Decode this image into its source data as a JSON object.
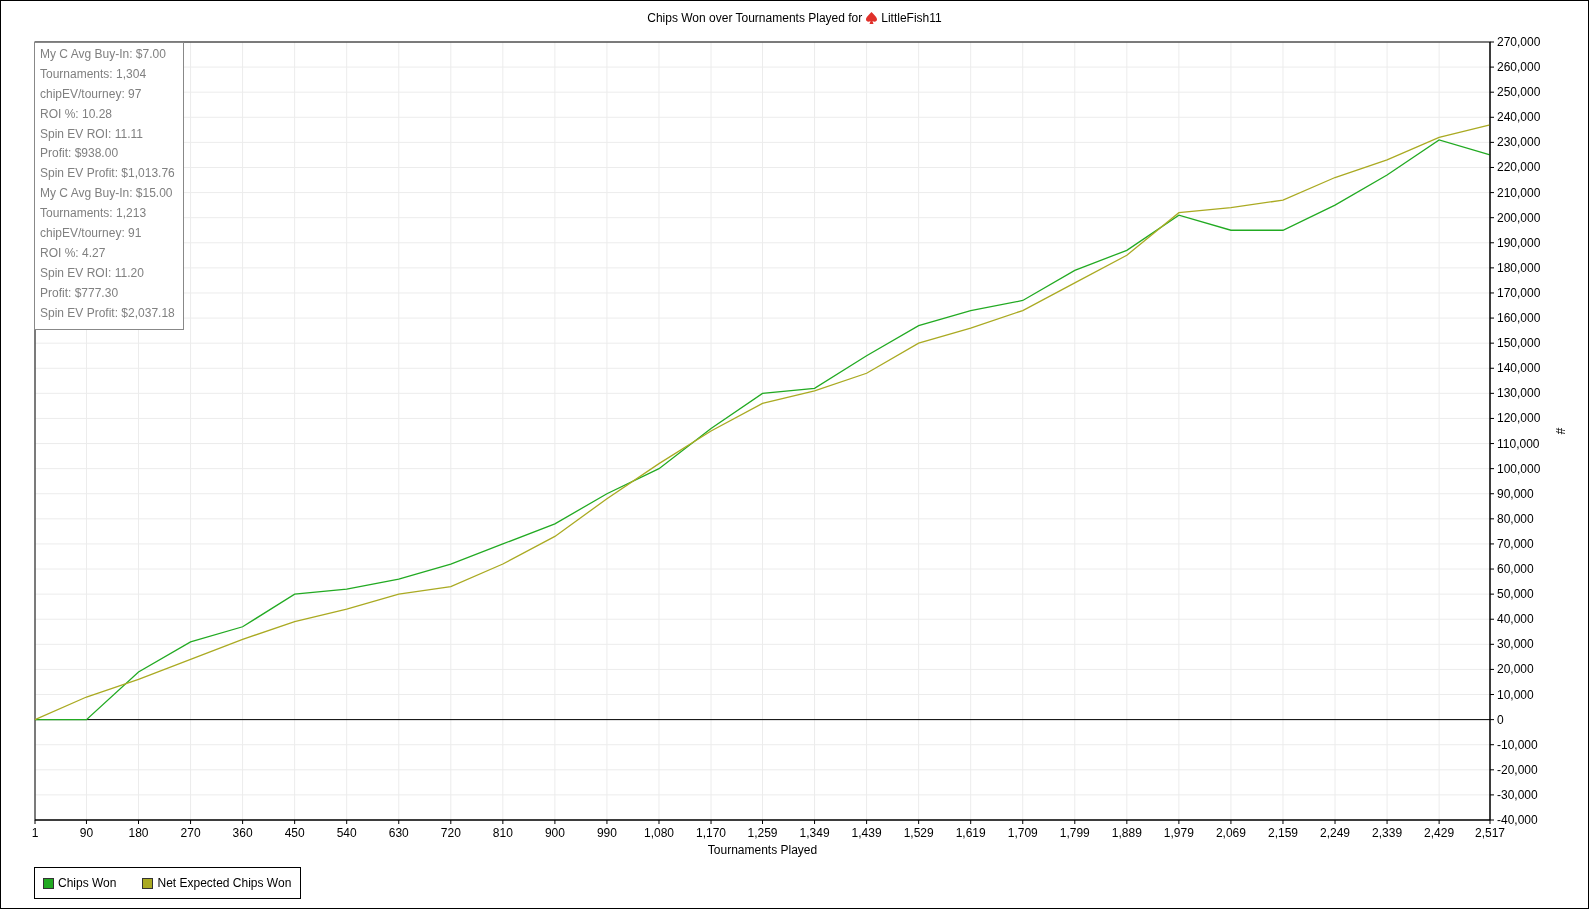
{
  "chart": {
    "title": "Chips Won over Tournaments Played for",
    "player": "LittleFish11",
    "stats": [
      "My C Avg Buy-In: $7.00",
      "Tournaments: 1,304",
      "chipEV/tourney: 97",
      "ROI %: 10.28",
      "Spin EV ROI: 11.11",
      "Profit: $938.00",
      "Spin EV Profit: $1,013.76",
      "My C Avg Buy-In: $15.00",
      "Tournaments: 1,213",
      "chipEV/tourney: 91",
      "ROI %: 4.27",
      "Spin EV ROI: 11.20",
      "Profit: $777.30",
      "Spin EV Profit: $2,037.18"
    ],
    "chart_data": {
      "type": "line",
      "xlabel": "Tournaments Played",
      "ylabel": "#",
      "x": [
        1,
        90,
        180,
        270,
        360,
        450,
        540,
        630,
        720,
        810,
        900,
        990,
        1080,
        1170,
        1259,
        1349,
        1439,
        1529,
        1619,
        1709,
        1799,
        1889,
        1979,
        2069,
        2159,
        2249,
        2339,
        2429,
        2517
      ],
      "series": [
        {
          "name": "Chips Won",
          "color": "#22aa22",
          "values": [
            0,
            0,
            19000,
            31000,
            37000,
            50000,
            52000,
            56000,
            62000,
            70000,
            78000,
            90000,
            100000,
            116000,
            130000,
            132000,
            145000,
            157000,
            163000,
            167000,
            179000,
            187000,
            201000,
            195000,
            195000,
            205000,
            217000,
            231000,
            225000
          ]
        },
        {
          "name": "Net Expected Chips Won",
          "color": "#aaaa22",
          "values": [
            0,
            9000,
            16000,
            24000,
            32000,
            39000,
            44000,
            50000,
            53000,
            62000,
            73000,
            88000,
            102000,
            115000,
            126000,
            131000,
            138000,
            150000,
            156000,
            163000,
            174000,
            185000,
            202000,
            204000,
            207000,
            216000,
            223000,
            232000,
            237000
          ]
        }
      ],
      "grid": true,
      "xlim": [
        1,
        2517
      ],
      "ylim": [
        -40000,
        270000
      ],
      "xticks": [
        1,
        90,
        180,
        270,
        360,
        450,
        540,
        630,
        720,
        810,
        900,
        990,
        {
          "value": 1080,
          "label": "1,080"
        },
        {
          "value": 1170,
          "label": "1,170"
        },
        {
          "value": 1259,
          "label": "1,259"
        },
        {
          "value": 1349,
          "label": "1,349"
        },
        {
          "value": 1439,
          "label": "1,439"
        },
        {
          "value": 1529,
          "label": "1,529"
        },
        {
          "value": 1619,
          "label": "1,619"
        },
        {
          "value": 1709,
          "label": "1,709"
        },
        {
          "value": 1799,
          "label": "1,799"
        },
        {
          "value": 1889,
          "label": "1,889"
        },
        {
          "value": 1979,
          "label": "1,979"
        },
        {
          "value": 2069,
          "label": "2,069"
        },
        {
          "value": 2159,
          "label": "2,159"
        },
        {
          "value": 2249,
          "label": "2,249"
        },
        {
          "value": 2339,
          "label": "2,339"
        },
        {
          "value": 2429,
          "label": "2,429"
        },
        {
          "value": 2517,
          "label": "2,517"
        }
      ],
      "yticks": [
        {
          "value": -40000,
          "label": "-40,000"
        },
        {
          "value": -30000,
          "label": "-30,000"
        },
        {
          "value": -20000,
          "label": "-20,000"
        },
        {
          "value": -10000,
          "label": "-10,000"
        },
        0,
        {
          "value": 10000,
          "label": "10,000"
        },
        {
          "value": 20000,
          "label": "20,000"
        },
        {
          "value": 30000,
          "label": "30,000"
        },
        {
          "value": 40000,
          "label": "40,000"
        },
        {
          "value": 50000,
          "label": "50,000"
        },
        {
          "value": 60000,
          "label": "60,000"
        },
        {
          "value": 70000,
          "label": "70,000"
        },
        {
          "value": 80000,
          "label": "80,000"
        },
        {
          "value": 90000,
          "label": "90,000"
        },
        {
          "value": 100000,
          "label": "100,000"
        },
        {
          "value": 110000,
          "label": "110,000"
        },
        {
          "value": 120000,
          "label": "120,000"
        },
        {
          "value": 130000,
          "label": "130,000"
        },
        {
          "value": 140000,
          "label": "140,000"
        },
        {
          "value": 150000,
          "label": "150,000"
        },
        {
          "value": 160000,
          "label": "160,000"
        },
        {
          "value": 170000,
          "label": "170,000"
        },
        {
          "value": 180000,
          "label": "180,000"
        },
        {
          "value": 190000,
          "label": "190,000"
        },
        {
          "value": 200000,
          "label": "200,000"
        },
        {
          "value": 210000,
          "label": "210,000"
        },
        {
          "value": 220000,
          "label": "220,000"
        },
        {
          "value": 230000,
          "label": "230,000"
        },
        {
          "value": 240000,
          "label": "240,000"
        },
        {
          "value": 250000,
          "label": "250,000"
        },
        {
          "value": 260000,
          "label": "260,000"
        },
        {
          "value": 270000,
          "label": "270,000"
        }
      ]
    }
  }
}
